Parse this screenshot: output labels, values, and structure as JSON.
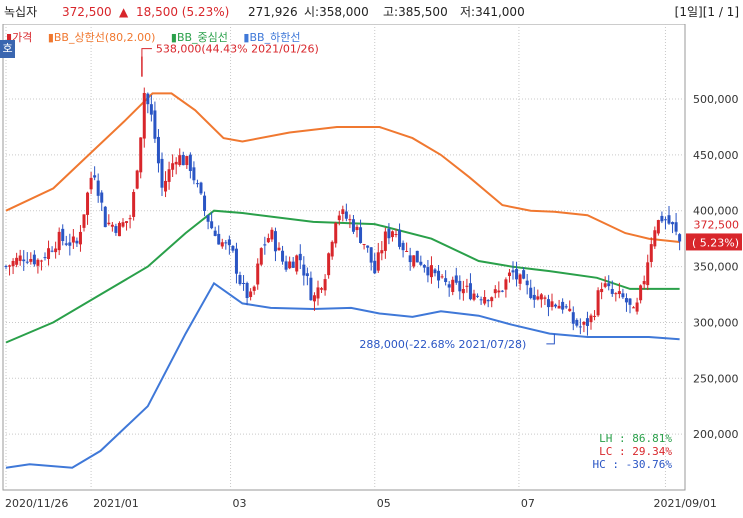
{
  "header": {
    "name": "녹십자",
    "price": "372,500",
    "change_arrow": "▲",
    "change": "18,500 (5.23%)",
    "volume": "271,926",
    "open": "시:358,000",
    "high": "고:385,500",
    "low": "저:341,000",
    "page": "[1일][1 / 1]"
  },
  "legend": {
    "price": "가격",
    "upper": "BB_상한선(80,2.00)",
    "mid": "BB_중심선",
    "lower": "BB_하한선"
  },
  "side_tab": "호",
  "badge": {
    "price": "372,500",
    "pct": "( 5.23%)"
  },
  "annotations": {
    "high": "538,000(44.43% 2021/01/26)",
    "low": "288,000(-22.68% 2021/07/28)"
  },
  "stats": {
    "lh": "LH : 86.81%",
    "lc": "LC : 29.34%",
    "hc": "HC : -30.76%"
  },
  "colors": {
    "up": "#d8262b",
    "down": "#2a55c4",
    "upper": "#f07830",
    "mid": "#2aa04a",
    "lower": "#3f78d8",
    "grid": "#c9c9c9"
  },
  "chart_data": {
    "type": "candlestick",
    "y_range": [
      150000,
      560000
    ],
    "y_ticks": [
      200000,
      250000,
      300000,
      350000,
      400000,
      450000,
      500000
    ],
    "y_tick_labels": [
      "200,000",
      "250,000",
      "300,000",
      "350,000",
      "400,000",
      "450,000",
      "500,000"
    ],
    "x_labels": [
      {
        "label": "2020/11/26",
        "d": 0
      },
      {
        "label": "2021/01",
        "d": 36
      },
      {
        "label": "03",
        "d": 95
      },
      {
        "label": "05",
        "d": 156
      },
      {
        "label": "07",
        "d": 217
      },
      {
        "label": "2021/09/01",
        "d": 279
      }
    ],
    "close_path": [
      [
        0,
        350000
      ],
      [
        8,
        360000
      ],
      [
        14,
        355000
      ],
      [
        22,
        375000
      ],
      [
        30,
        370000
      ],
      [
        37,
        440000
      ],
      [
        42,
        390000
      ],
      [
        48,
        385000
      ],
      [
        53,
        395000
      ],
      [
        57,
        470000
      ],
      [
        58,
        510000
      ],
      [
        62,
        480000
      ],
      [
        66,
        420000
      ],
      [
        72,
        450000
      ],
      [
        78,
        440000
      ],
      [
        84,
        400000
      ],
      [
        88,
        380000
      ],
      [
        92,
        370000
      ],
      [
        96,
        360000
      ],
      [
        100,
        330000
      ],
      [
        104,
        320000
      ],
      [
        108,
        365000
      ],
      [
        112,
        380000
      ],
      [
        118,
        350000
      ],
      [
        124,
        360000
      ],
      [
        130,
        320000
      ],
      [
        135,
        345000
      ],
      [
        140,
        400000
      ],
      [
        146,
        390000
      ],
      [
        152,
        370000
      ],
      [
        156,
        345000
      ],
      [
        160,
        375000
      ],
      [
        164,
        385000
      ],
      [
        170,
        360000
      ],
      [
        176,
        355000
      ],
      [
        184,
        335000
      ],
      [
        192,
        330000
      ],
      [
        200,
        325000
      ],
      [
        208,
        325000
      ],
      [
        214,
        345000
      ],
      [
        220,
        330000
      ],
      [
        228,
        320000
      ],
      [
        236,
        315000
      ],
      [
        240,
        300000
      ],
      [
        244,
        295000
      ],
      [
        248,
        305000
      ],
      [
        252,
        335000
      ],
      [
        256,
        325000
      ],
      [
        262,
        320000
      ],
      [
        266,
        305000
      ],
      [
        270,
        340000
      ],
      [
        274,
        385000
      ],
      [
        278,
        395000
      ],
      [
        282,
        385000
      ],
      [
        285,
        372500
      ]
    ],
    "bb_upper": [
      [
        0,
        400000
      ],
      [
        20,
        420000
      ],
      [
        35,
        450000
      ],
      [
        50,
        480000
      ],
      [
        62,
        505000
      ],
      [
        70,
        505000
      ],
      [
        80,
        490000
      ],
      [
        92,
        465000
      ],
      [
        100,
        462000
      ],
      [
        120,
        470000
      ],
      [
        140,
        475000
      ],
      [
        158,
        475000
      ],
      [
        172,
        465000
      ],
      [
        184,
        450000
      ],
      [
        196,
        430000
      ],
      [
        210,
        405000
      ],
      [
        222,
        400000
      ],
      [
        232,
        399000
      ],
      [
        246,
        396000
      ],
      [
        262,
        380000
      ],
      [
        272,
        375000
      ],
      [
        285,
        372000
      ]
    ],
    "bb_mid": [
      [
        0,
        282000
      ],
      [
        20,
        300000
      ],
      [
        40,
        325000
      ],
      [
        60,
        350000
      ],
      [
        76,
        380000
      ],
      [
        88,
        400000
      ],
      [
        100,
        398000
      ],
      [
        130,
        390000
      ],
      [
        156,
        388000
      ],
      [
        180,
        375000
      ],
      [
        200,
        355000
      ],
      [
        214,
        350000
      ],
      [
        230,
        346000
      ],
      [
        250,
        340000
      ],
      [
        264,
        330000
      ],
      [
        278,
        330000
      ],
      [
        285,
        330000
      ]
    ],
    "bb_lower": [
      [
        0,
        170000
      ],
      [
        10,
        173000
      ],
      [
        28,
        170000
      ],
      [
        40,
        185000
      ],
      [
        60,
        225000
      ],
      [
        76,
        290000
      ],
      [
        88,
        335000
      ],
      [
        100,
        317000
      ],
      [
        112,
        313000
      ],
      [
        130,
        312000
      ],
      [
        146,
        313000
      ],
      [
        158,
        308000
      ],
      [
        172,
        305000
      ],
      [
        184,
        310000
      ],
      [
        200,
        306000
      ],
      [
        214,
        298000
      ],
      [
        230,
        290000
      ],
      [
        246,
        287000
      ],
      [
        262,
        287000
      ],
      [
        272,
        287000
      ],
      [
        285,
        285000
      ]
    ],
    "series": [
      {
        "name": "가격"
      },
      {
        "name": "BB_상한선(80,2.00)"
      },
      {
        "name": "BB_중심선"
      },
      {
        "name": "BB_하한선"
      }
    ]
  }
}
